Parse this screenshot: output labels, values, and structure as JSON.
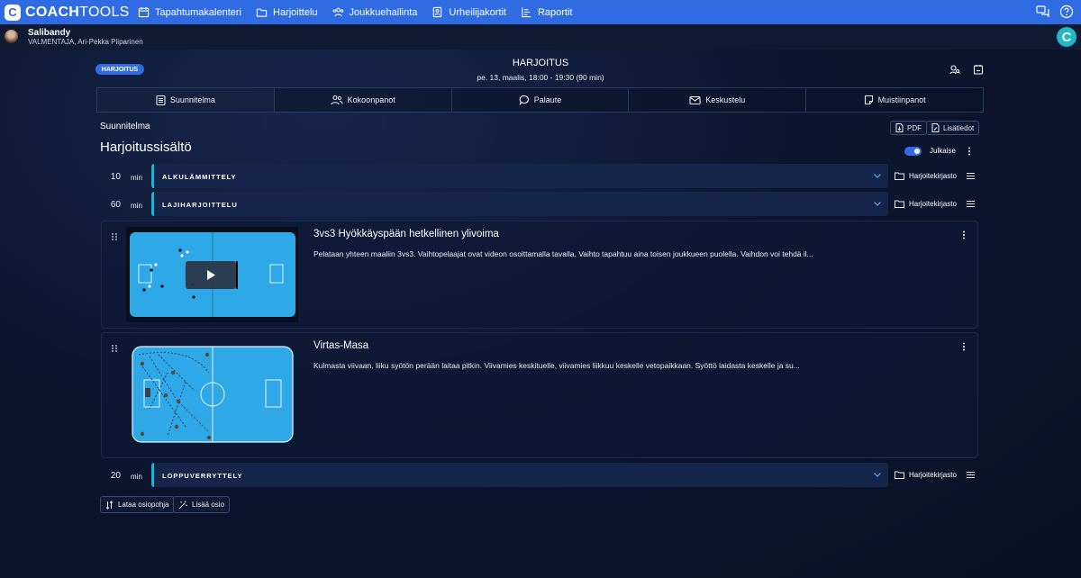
{
  "app": {
    "brand_bold": "COACH",
    "brand_light": "TOOLS",
    "logo_letter": "C"
  },
  "nav": {
    "items": [
      {
        "label": "Tapahtumakalenteri",
        "icon": "calendar-icon"
      },
      {
        "label": "Harjoittelu",
        "icon": "folder-icon"
      },
      {
        "label": "Joukkuehallinta",
        "icon": "team-icon"
      },
      {
        "label": "Urheilijakortit",
        "icon": "id-card-icon"
      },
      {
        "label": "Raportit",
        "icon": "report-icon"
      }
    ]
  },
  "user": {
    "team": "Salibandy",
    "role_name": "VALMENTAJA, Ari-Pekka Piiparinen"
  },
  "event": {
    "chip": "HARJOITUS",
    "title": "HARJOITUS",
    "time": "pe. 13, maalis, 18:00 - 19:30 (90 min)"
  },
  "tabs": [
    {
      "label": "Suunnitelma",
      "icon": "clipboard-icon"
    },
    {
      "label": "Kokoonpanot",
      "icon": "people-icon"
    },
    {
      "label": "Palaute",
      "icon": "chat-bubble-icon"
    },
    {
      "label": "Keskustelu",
      "icon": "mail-icon"
    },
    {
      "label": "Muistiinpanot",
      "icon": "note-icon"
    }
  ],
  "plan": {
    "section_label": "Suunnitelma",
    "title": "Harjoitussisältö",
    "pdf_label": "PDF",
    "details_label": "Lisätiedot",
    "publish_label": "Julkaise",
    "publish_on": true,
    "library_label": "Harjoitekirjasto",
    "min_label": "min",
    "sections": [
      {
        "minutes": "10",
        "name": "ALKULÄMMITTELY"
      },
      {
        "minutes": "60",
        "name": "LAJIHARJOITTELU"
      },
      {
        "minutes": "20",
        "name": "LOPPUVERRYTTELY"
      }
    ],
    "drills": [
      {
        "title": "3vs3 Hyökkäyspään hetkellinen ylivoima",
        "desc": "Pelataan yhteen maaliin 3vs3. Vaihtopelaajat ovat videon osoittamalla tavalla. Vaihto tapahtuu aina toisen joukkueen puolella. Vaihdon voi tehdä il..."
      },
      {
        "title": "Virtas-Masa",
        "desc": "Kulmasta viivaan, liiku syötön perään laitaa pitkin. Viivamies keskituelle, viivamies liikkuu keskelle vetopaikkaan. Syöttö laidasta keskelle ja su..."
      }
    ],
    "load_template_label": "Lataa osiopohja",
    "add_section_label": "Lisää osio"
  },
  "colors": {
    "accent": "#2f6be3",
    "section_bar": "#1fb3cf",
    "court": "#2ea8e6"
  }
}
